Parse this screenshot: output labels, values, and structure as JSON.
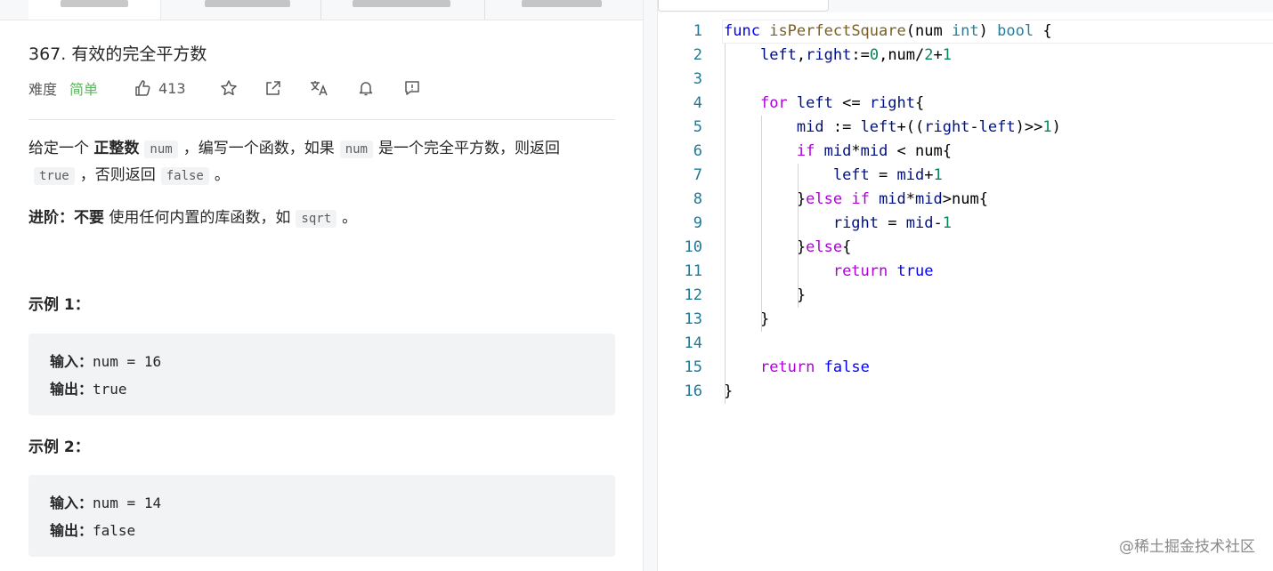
{
  "problem": {
    "title": "367. 有效的完全平方数",
    "difficulty_label": "难度",
    "difficulty_value": "简单",
    "likes": "413"
  },
  "description": {
    "p1_a": "给定一个 ",
    "p1_bold": "正整数",
    "p1_code1": "num",
    "p1_b": "，编写一个函数，如果",
    "p1_code2": "num",
    "p1_c": "是一个完全平方数，则返回",
    "p1_code3": "true",
    "p1_d": "，否则返回",
    "p1_code4": "false",
    "p1_e": "。",
    "adv_bold1": "进阶：",
    "adv_bold2": "不要",
    "adv_text": " 使用任何内置的库函数，如",
    "adv_code": "sqrt",
    "adv_end": "。"
  },
  "examples": [
    {
      "title": "示例 1：",
      "input_label": "输入：",
      "input_value": "num = 16",
      "output_label": "输出：",
      "output_value": "true"
    },
    {
      "title": "示例 2：",
      "input_label": "输入：",
      "input_value": "num = 14",
      "output_label": "输出：",
      "output_value": "false"
    }
  ],
  "editor": {
    "line_numbers": [
      "1",
      "2",
      "3",
      "4",
      "5",
      "6",
      "7",
      "8",
      "9",
      "10",
      "11",
      "12",
      "13",
      "14",
      "15",
      "16"
    ],
    "code_lines": [
      "func isPerfectSquare(num int) bool {",
      "    left,right:=0,num/2+1",
      "",
      "    for left <= right{",
      "        mid := left+((right-left)>>1)",
      "        if mid*mid < num{",
      "            left = mid+1",
      "        }else if mid*mid>num{",
      "            right = mid-1",
      "        }else{",
      "            return true",
      "        }",
      "    }",
      "",
      "    return false",
      "}"
    ]
  },
  "watermark": "@稀土掘金技术社区",
  "icons": {
    "like": "thumbs-up-icon",
    "star": "star-icon",
    "share": "share-icon",
    "translate": "translate-icon",
    "bell": "bell-icon",
    "feedback": "feedback-icon"
  },
  "colors": {
    "difficulty_easy": "#5cb85c",
    "line_number": "#237893",
    "keyword": "#0000ff",
    "function": "#795e26",
    "type": "#267f99",
    "control": "#af00db",
    "number": "#098658"
  }
}
